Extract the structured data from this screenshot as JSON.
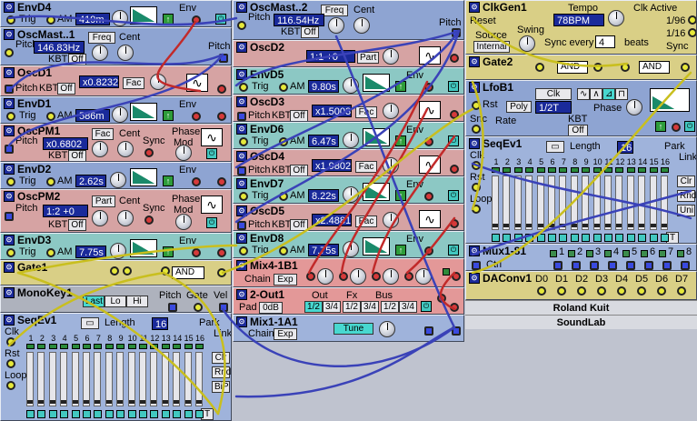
{
  "modules": {
    "envd4": {
      "title": "EnvD4",
      "trig": "Trig",
      "am": "AM",
      "value": "419m",
      "env": "Env"
    },
    "oscmaster1": {
      "title": "OscMast..1",
      "pitch": "Pitch",
      "freq": "Freq",
      "cent": "Cent",
      "value": "146.83Hz",
      "kbt": "KBT",
      "off": "Off",
      "pitch_out": "Pitch"
    },
    "oscd1": {
      "title": "OscD1",
      "pitch": "Pitch",
      "kbt": "KBT",
      "off": "Off",
      "value": "x0.8232",
      "fac": "Fac"
    },
    "envd1": {
      "title": "EnvD1",
      "trig": "Trig",
      "am": "AM",
      "value": "586m",
      "env": "Env"
    },
    "oscpm1": {
      "title": "OscPM1",
      "pitch": "Pitch",
      "fac": "Fac",
      "cent": "Cent",
      "value": "x0.6802",
      "kbt": "KBT",
      "off": "Off",
      "sync": "Sync",
      "phase": "Phase",
      "mod": "Mod"
    },
    "envd2": {
      "title": "EnvD2",
      "trig": "Trig",
      "am": "AM",
      "value": "2.62s",
      "env": "Env"
    },
    "oscpm2": {
      "title": "OscPM2",
      "pitch": "Pitch",
      "part": "Part",
      "cent": "Cent",
      "value": "1:2  +0",
      "kbt": "KBT",
      "off": "Off",
      "sync": "Sync",
      "phase": "Phase",
      "mod": "Mod"
    },
    "envd3": {
      "title": "EnvD3",
      "trig": "Trig",
      "am": "AM",
      "value": "7.75s",
      "env": "Env"
    },
    "gate1": {
      "title": "Gate1",
      "and": "AND"
    },
    "monokey1": {
      "title": "MonoKey1",
      "last": "Last",
      "lo": "Lo",
      "hi": "Hi",
      "pitch": "Pitch",
      "gate": "Gate",
      "vel": "Vel"
    },
    "seq1": {
      "title": "SeqEv1",
      "length": "Length",
      "length_val": "16",
      "park": "Park",
      "link": "Link",
      "clk": "Clk",
      "rst": "Rst",
      "loop": "Loop",
      "clr": "Clr",
      "rnd": "Rnd",
      "bip": "BiP",
      "t": "T",
      "steps": [
        "1",
        "2",
        "3",
        "4",
        "5",
        "6",
        "7",
        "8",
        "9",
        "10",
        "11",
        "12",
        "13",
        "14",
        "15",
        "16"
      ]
    },
    "oscmaster2": {
      "title": "OscMast..2",
      "pitch": "Pitch",
      "freq": "Freq",
      "cent": "Cent",
      "value": "116.54Hz",
      "kbt": "KBT",
      "off": "Off",
      "pitch_out": "Pitch"
    },
    "oscd2": {
      "title": "OscD2",
      "value": "1:1  +0",
      "part": "Part"
    },
    "envd5": {
      "title": "EnvD5",
      "trig": "Trig",
      "am": "AM",
      "value": "9.80s",
      "env": "Env"
    },
    "oscd3": {
      "title": "OscD3",
      "pitch": "Pitch",
      "kbt": "KBT",
      "off": "Off",
      "value": "x1.5003",
      "fac": "Fac"
    },
    "envd6": {
      "title": "EnvD6",
      "trig": "Trig",
      "am": "AM",
      "value": "6.47s",
      "env": "Env"
    },
    "oscd4": {
      "title": "OscD4",
      "pitch": "Pitch",
      "kbt": "KBT",
      "off": "Off",
      "value": "x1.9802",
      "fac": "Fac"
    },
    "envd7": {
      "title": "EnvD7",
      "trig": "Trig",
      "am": "AM",
      "value": "8.22s",
      "env": "Env"
    },
    "oscd5": {
      "title": "OscD5",
      "pitch": "Pitch",
      "kbt": "KBT",
      "off": "Off",
      "value": "x2.4881",
      "fac": "Fac"
    },
    "envd8": {
      "title": "EnvD8",
      "trig": "Trig",
      "am": "AM",
      "value": "7.75s",
      "env": "Env"
    },
    "mix4": {
      "title": "Mix4-1B1",
      "chain": "Chain",
      "exp": "Exp"
    },
    "out2": {
      "title": "2-Out1",
      "pad": "Pad",
      "pad_val": "0dB",
      "out": "Out",
      "fx": "Fx",
      "bus": "Bus",
      "ch1": "1/2",
      "ch2": "3/4"
    },
    "mix1": {
      "title": "Mix1-1A1",
      "chain": "Chain",
      "exp": "Exp",
      "tune": "Tune"
    },
    "clkgen1": {
      "title": "ClkGen1",
      "reset": "Reset",
      "tempo": "Tempo",
      "tempo_val": "78BPM",
      "clk_active": "Clk Active",
      "source": "Source",
      "internal": "Internal",
      "swing": "Swing",
      "sync_every": "Sync every",
      "sync_val": "4",
      "beats": "beats",
      "div1": "1/96",
      "div2": "1/16",
      "sync": "Sync"
    },
    "gate2": {
      "title": "Gate2",
      "and1": "AND",
      "and2": "AND"
    },
    "lfob1": {
      "title": "LfoB1",
      "rst": "Rst",
      "clk": "Clk",
      "poly": "Poly",
      "div": "1/2T",
      "rate": "Rate",
      "kbt": "KBT",
      "off": "Off",
      "phase": "Phase",
      "snc": "Snc"
    },
    "seq2": {
      "title": "SeqEv1",
      "length": "Length",
      "length_val": "16",
      "park": "Park",
      "link": "Link",
      "clk": "Clk",
      "rst": "Rst",
      "loop": "Loop",
      "clr": "Clr",
      "rnd": "Rnd",
      "uni": "Uni",
      "t": "T"
    },
    "mux": {
      "title": "Mux1-81",
      "ctrl": "Ctrl",
      "steps": [
        "1",
        "2",
        "3",
        "4",
        "5",
        "6",
        "7",
        "8"
      ]
    },
    "dacconv": {
      "title": "DAConv1",
      "outs": [
        "D0",
        "D1",
        "D2",
        "D3",
        "D4",
        "D5",
        "D6",
        "D7"
      ]
    },
    "footer": {
      "line1": "Roland Kuit",
      "line2": "SoundLab"
    }
  },
  "colors": {
    "cable_yellow": "#c9bf1e",
    "cable_blue": "#3a42b8",
    "cable_red": "#c22a2a",
    "background": "#bfc3cf"
  }
}
